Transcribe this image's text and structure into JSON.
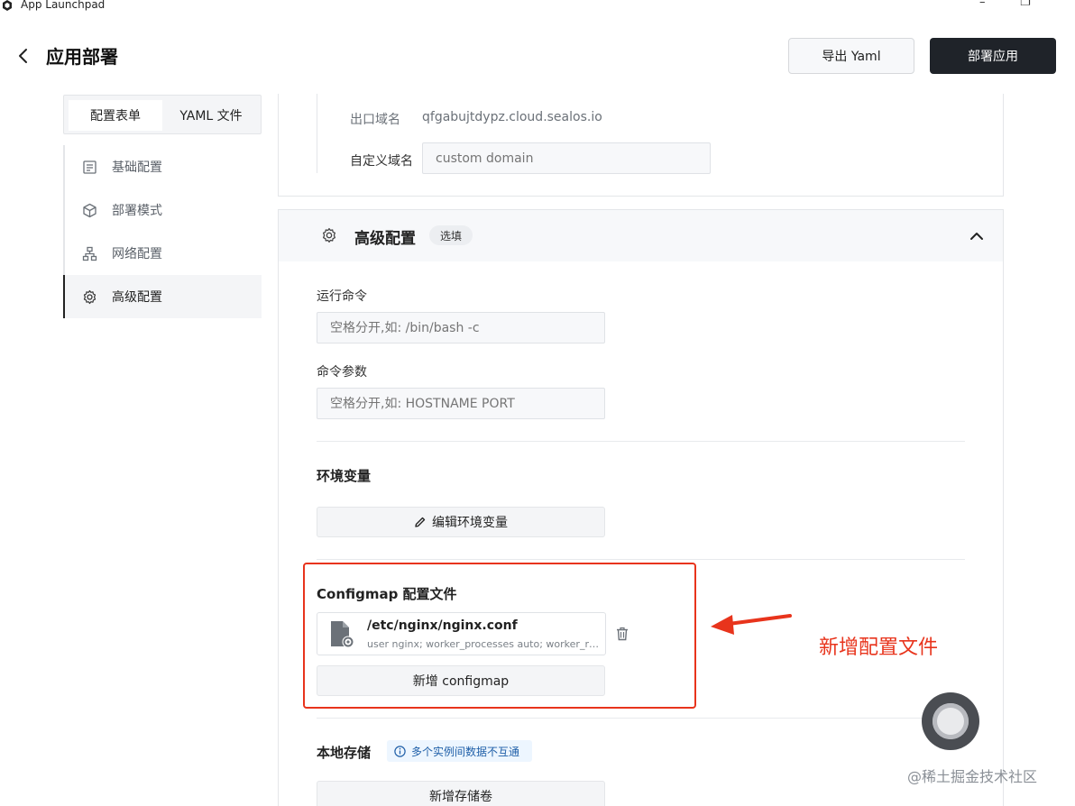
{
  "window": {
    "title": "App Launchpad",
    "minimize": "–",
    "restore": "❐"
  },
  "header": {
    "title": "应用部署",
    "export_label": "导出 Yaml",
    "deploy_label": "部署应用"
  },
  "tabs": [
    {
      "label": "配置表单"
    },
    {
      "label": "YAML 文件"
    }
  ],
  "nav": {
    "items": [
      {
        "label": "基础配置",
        "icon": "document-icon"
      },
      {
        "label": "部署模式",
        "icon": "cube-icon"
      },
      {
        "label": "网络配置",
        "icon": "network-icon"
      },
      {
        "label": "高级配置",
        "icon": "gear-icon",
        "active": true
      }
    ]
  },
  "network": {
    "outbound_label": "出口域名",
    "outbound_value": "qfgabujtdypz.cloud.sealos.io",
    "custom_label": "自定义域名",
    "custom_placeholder": "custom domain"
  },
  "advanced": {
    "title": "高级配置",
    "badge": "选填",
    "run_cmd_label": "运行命令",
    "run_cmd_placeholder": "空格分开,如: /bin/bash -c",
    "cmd_args_label": "命令参数",
    "cmd_args_placeholder": "空格分开,如: HOSTNAME PORT",
    "env_title": "环境变量",
    "env_button": "编辑环境变量",
    "configmap_title": "Configmap 配置文件",
    "configmap_files": [
      {
        "path": "/etc/nginx/nginx.conf",
        "preview": "user nginx; worker_processes auto; worker_rlimit_nofile"
      }
    ],
    "configmap_add": "新增 configmap",
    "storage_title": "本地存储",
    "storage_info": "多个实例间数据不互通",
    "storage_add": "新增存储卷"
  },
  "annotation": {
    "note": "新增配置文件",
    "color": "#e8341c"
  },
  "watermark": "@稀土掘金技术社区",
  "colors": {
    "primary_dark": "#1f2329",
    "panel_bg": "#f7f8fa",
    "info_bg": "#edf6ff",
    "info_text": "#1f5fa8"
  }
}
